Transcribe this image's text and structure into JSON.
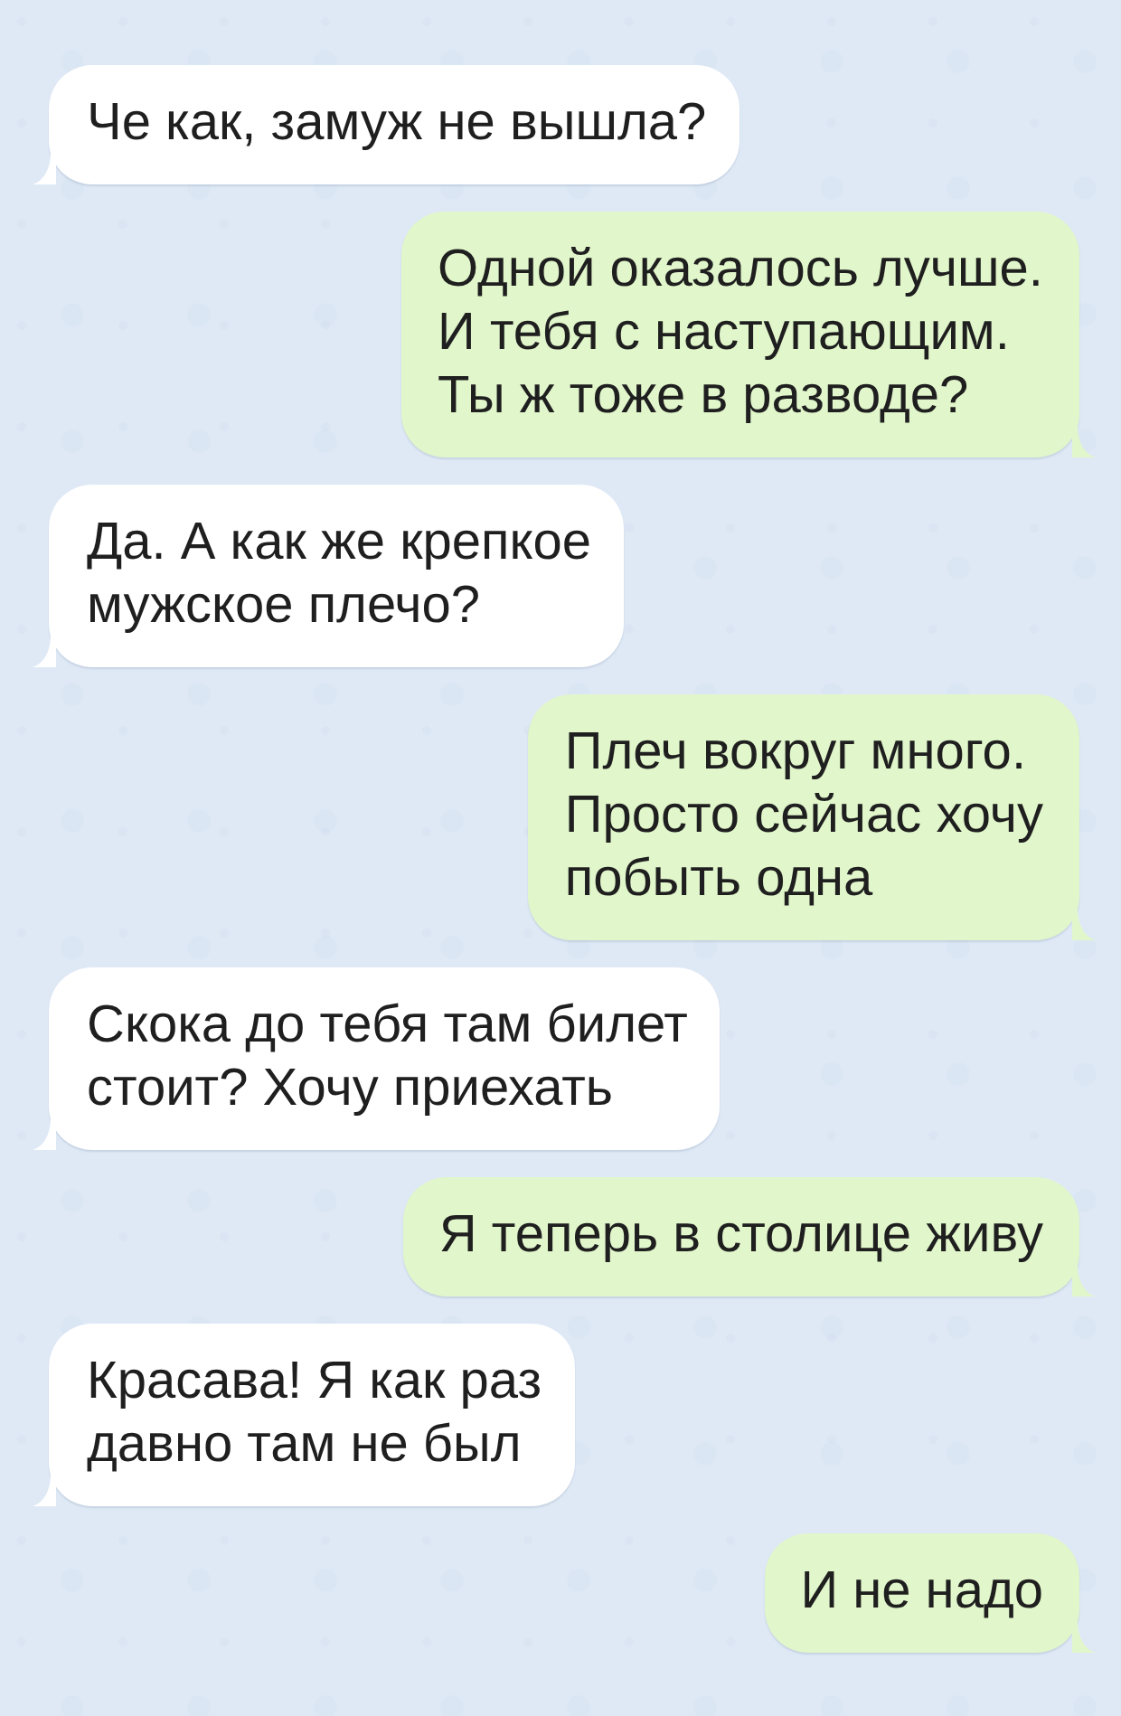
{
  "messages": [
    {
      "kind": "incoming",
      "lines": [
        "Че как, замуж не вышла?"
      ]
    },
    {
      "kind": "outgoing",
      "lines": [
        "Одной оказалось лучше.",
        "И тебя с наступающим.",
        "Ты ж тоже в разводе?"
      ]
    },
    {
      "kind": "incoming",
      "lines": [
        "Да. А как же крепкое",
        "мужское плечо?"
      ]
    },
    {
      "kind": "outgoing",
      "lines": [
        "Плеч вокруг много.",
        "Просто сейчас хочу",
        "побыть одна"
      ]
    },
    {
      "kind": "incoming",
      "lines": [
        "Скока до тебя там билет",
        "стоит? Хочу приехать"
      ]
    },
    {
      "kind": "outgoing",
      "lines": [
        "Я теперь в столице живу"
      ]
    },
    {
      "kind": "incoming",
      "lines": [
        "Красава! Я как раз",
        "давно там не был"
      ]
    },
    {
      "kind": "outgoing",
      "lines": [
        "И не надо"
      ]
    }
  ]
}
